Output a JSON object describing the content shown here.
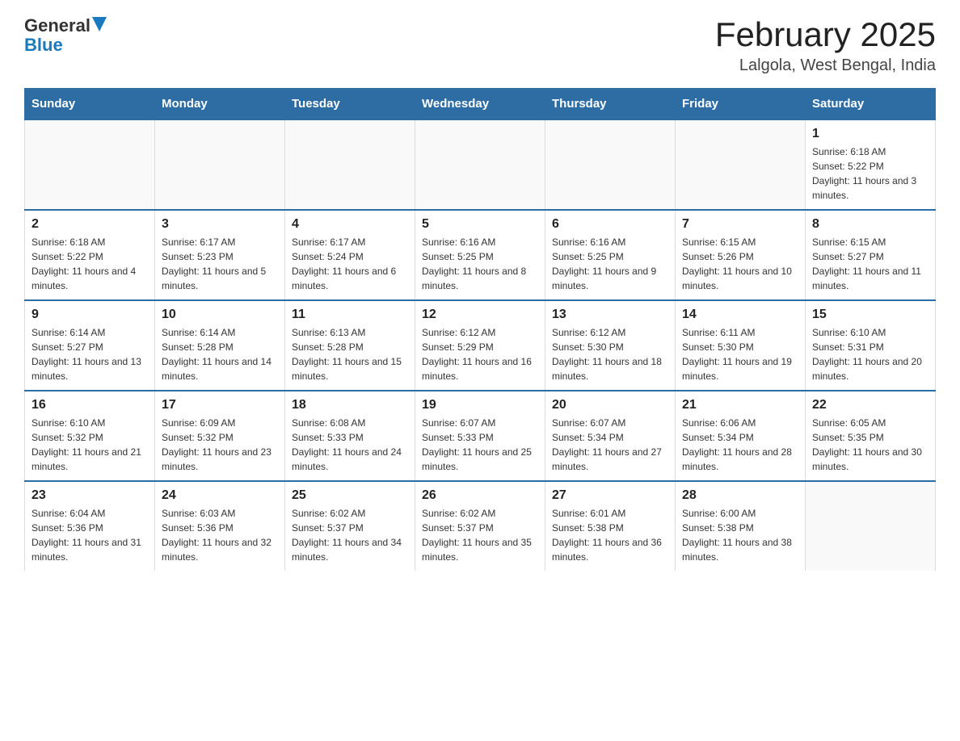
{
  "header": {
    "logo": {
      "general": "General",
      "blue": "Blue",
      "arrow": true
    },
    "title": "February 2025",
    "subtitle": "Lalgola, West Bengal, India"
  },
  "calendar": {
    "days_of_week": [
      "Sunday",
      "Monday",
      "Tuesday",
      "Wednesday",
      "Thursday",
      "Friday",
      "Saturday"
    ],
    "weeks": [
      [
        {
          "day": null
        },
        {
          "day": null
        },
        {
          "day": null
        },
        {
          "day": null
        },
        {
          "day": null
        },
        {
          "day": null
        },
        {
          "day": 1,
          "sunrise": "6:18 AM",
          "sunset": "5:22 PM",
          "daylight": "11 hours and 3 minutes."
        }
      ],
      [
        {
          "day": 2,
          "sunrise": "6:18 AM",
          "sunset": "5:22 PM",
          "daylight": "11 hours and 4 minutes."
        },
        {
          "day": 3,
          "sunrise": "6:17 AM",
          "sunset": "5:23 PM",
          "daylight": "11 hours and 5 minutes."
        },
        {
          "day": 4,
          "sunrise": "6:17 AM",
          "sunset": "5:24 PM",
          "daylight": "11 hours and 6 minutes."
        },
        {
          "day": 5,
          "sunrise": "6:16 AM",
          "sunset": "5:25 PM",
          "daylight": "11 hours and 8 minutes."
        },
        {
          "day": 6,
          "sunrise": "6:16 AM",
          "sunset": "5:25 PM",
          "daylight": "11 hours and 9 minutes."
        },
        {
          "day": 7,
          "sunrise": "6:15 AM",
          "sunset": "5:26 PM",
          "daylight": "11 hours and 10 minutes."
        },
        {
          "day": 8,
          "sunrise": "6:15 AM",
          "sunset": "5:27 PM",
          "daylight": "11 hours and 11 minutes."
        }
      ],
      [
        {
          "day": 9,
          "sunrise": "6:14 AM",
          "sunset": "5:27 PM",
          "daylight": "11 hours and 13 minutes."
        },
        {
          "day": 10,
          "sunrise": "6:14 AM",
          "sunset": "5:28 PM",
          "daylight": "11 hours and 14 minutes."
        },
        {
          "day": 11,
          "sunrise": "6:13 AM",
          "sunset": "5:28 PM",
          "daylight": "11 hours and 15 minutes."
        },
        {
          "day": 12,
          "sunrise": "6:12 AM",
          "sunset": "5:29 PM",
          "daylight": "11 hours and 16 minutes."
        },
        {
          "day": 13,
          "sunrise": "6:12 AM",
          "sunset": "5:30 PM",
          "daylight": "11 hours and 18 minutes."
        },
        {
          "day": 14,
          "sunrise": "6:11 AM",
          "sunset": "5:30 PM",
          "daylight": "11 hours and 19 minutes."
        },
        {
          "day": 15,
          "sunrise": "6:10 AM",
          "sunset": "5:31 PM",
          "daylight": "11 hours and 20 minutes."
        }
      ],
      [
        {
          "day": 16,
          "sunrise": "6:10 AM",
          "sunset": "5:32 PM",
          "daylight": "11 hours and 21 minutes."
        },
        {
          "day": 17,
          "sunrise": "6:09 AM",
          "sunset": "5:32 PM",
          "daylight": "11 hours and 23 minutes."
        },
        {
          "day": 18,
          "sunrise": "6:08 AM",
          "sunset": "5:33 PM",
          "daylight": "11 hours and 24 minutes."
        },
        {
          "day": 19,
          "sunrise": "6:07 AM",
          "sunset": "5:33 PM",
          "daylight": "11 hours and 25 minutes."
        },
        {
          "day": 20,
          "sunrise": "6:07 AM",
          "sunset": "5:34 PM",
          "daylight": "11 hours and 27 minutes."
        },
        {
          "day": 21,
          "sunrise": "6:06 AM",
          "sunset": "5:34 PM",
          "daylight": "11 hours and 28 minutes."
        },
        {
          "day": 22,
          "sunrise": "6:05 AM",
          "sunset": "5:35 PM",
          "daylight": "11 hours and 30 minutes."
        }
      ],
      [
        {
          "day": 23,
          "sunrise": "6:04 AM",
          "sunset": "5:36 PM",
          "daylight": "11 hours and 31 minutes."
        },
        {
          "day": 24,
          "sunrise": "6:03 AM",
          "sunset": "5:36 PM",
          "daylight": "11 hours and 32 minutes."
        },
        {
          "day": 25,
          "sunrise": "6:02 AM",
          "sunset": "5:37 PM",
          "daylight": "11 hours and 34 minutes."
        },
        {
          "day": 26,
          "sunrise": "6:02 AM",
          "sunset": "5:37 PM",
          "daylight": "11 hours and 35 minutes."
        },
        {
          "day": 27,
          "sunrise": "6:01 AM",
          "sunset": "5:38 PM",
          "daylight": "11 hours and 36 minutes."
        },
        {
          "day": 28,
          "sunrise": "6:00 AM",
          "sunset": "5:38 PM",
          "daylight": "11 hours and 38 minutes."
        },
        {
          "day": null
        }
      ]
    ]
  }
}
